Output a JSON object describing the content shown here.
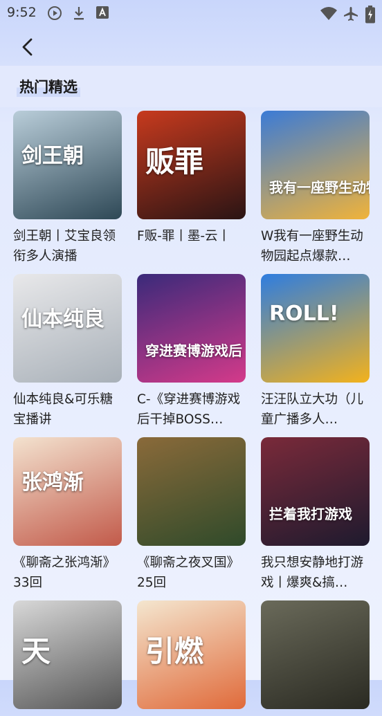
{
  "status_bar": {
    "time": "9:52",
    "icons": [
      "play-circle-icon",
      "download-icon",
      "a-badge-icon",
      "wifi-icon",
      "airplane-icon",
      "battery-charging-icon"
    ]
  },
  "nav": {
    "back_icon": "chevron-left-icon"
  },
  "section": {
    "title": "热门精选"
  },
  "cards": [
    {
      "title": "剑王朝丨艾宝良领衔多人演播",
      "cover_text": "剑王朝",
      "colors": [
        "#b9cdd9",
        "#2e4856"
      ]
    },
    {
      "title": "F贩-罪丨墨-云丨",
      "cover_text": "贩罪",
      "colors": [
        "#c73a1e",
        "#2a1414"
      ]
    },
    {
      "title": "W我有一座野生动物园起点爆款…",
      "cover_text": "我有一座野生动物园",
      "colors": [
        "#3b7bd6",
        "#f0b33a"
      ]
    },
    {
      "title": "仙本纯良&可乐糖宝播讲",
      "cover_text": "仙本纯良",
      "colors": [
        "#e8e8ea",
        "#a8b0b8"
      ]
    },
    {
      "title": "C-《穿进赛博游戏后干掉BOSS…",
      "cover_text": "穿进赛博游戏后",
      "colors": [
        "#3a2a7a",
        "#d43a8a"
      ]
    },
    {
      "title": "汪汪队立大功（儿童广播多人…",
      "cover_text": "ROLL!",
      "colors": [
        "#2e7de0",
        "#f3b21c"
      ]
    },
    {
      "title": "《聊斋之张鸿渐》33回",
      "cover_text": "张鸿渐",
      "colors": [
        "#f3e2cf",
        "#c25a4a"
      ]
    },
    {
      "title": "《聊斋之夜叉国》25回",
      "cover_text": "",
      "colors": [
        "#8a6a3a",
        "#2f4a2a"
      ]
    },
    {
      "title": "我只想安静地打游戏丨爆爽&搞…",
      "cover_text": "拦着我打游戏",
      "colors": [
        "#7a2a3a",
        "#1e1a2e"
      ]
    },
    {
      "title": "",
      "cover_text": "天",
      "colors": [
        "#d8d8d8",
        "#555555"
      ]
    },
    {
      "title": "",
      "cover_text": "引燃",
      "colors": [
        "#f4e6cf",
        "#e06a3a"
      ]
    },
    {
      "title": "",
      "cover_text": "",
      "colors": [
        "#6a6a5a",
        "#2a2a22"
      ]
    }
  ]
}
